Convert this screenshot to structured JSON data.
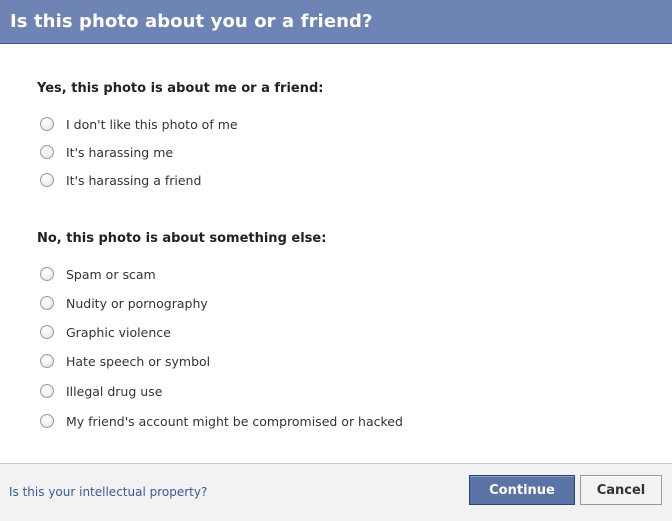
{
  "dialog": {
    "title": "Is this photo about you or a friend?"
  },
  "sections": {
    "about_me": {
      "heading": "Yes, this photo is about me or a friend:",
      "options": [
        "I don't like this photo of me",
        "It's harassing me",
        "It's harassing a friend"
      ]
    },
    "something_else": {
      "heading": "No, this photo is about something else:",
      "options": [
        "Spam or scam",
        "Nudity or pornography",
        "Graphic violence",
        "Hate speech or symbol",
        "Illegal drug use",
        "My friend's account might be compromised or hacked"
      ]
    }
  },
  "footer": {
    "ip_link": "Is this your intellectual property?",
    "continue_label": "Continue",
    "cancel_label": "Cancel"
  },
  "colors": {
    "titlebar": "#6d84b4",
    "link": "#3b5998",
    "primary_button": "#5b74a8"
  }
}
